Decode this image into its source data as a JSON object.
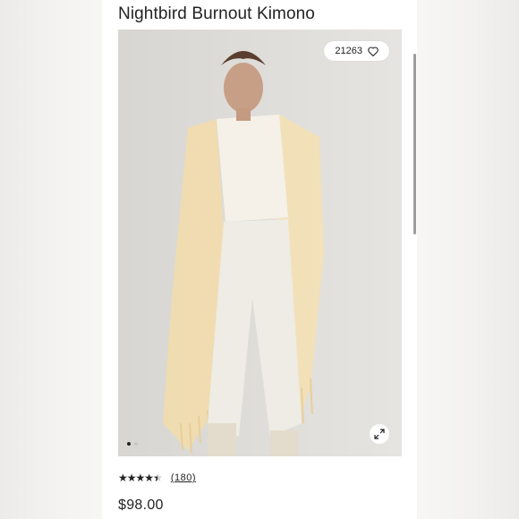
{
  "product": {
    "title": "Nightbird Burnout Kimono",
    "like_count": "21263",
    "rating_value": 4.5,
    "rating_max": 5,
    "review_count": "(180)",
    "price": "$98.00"
  },
  "carousel": {
    "total_images": 2,
    "active_index": 0
  },
  "icons": {
    "like": "heart-outline-icon",
    "expand": "expand-arrows-icon",
    "star": "star-icon"
  },
  "colors": {
    "background": "#f1f0ef",
    "card": "#ffffff",
    "text": "#222222",
    "kimono": "#f0dcae"
  }
}
